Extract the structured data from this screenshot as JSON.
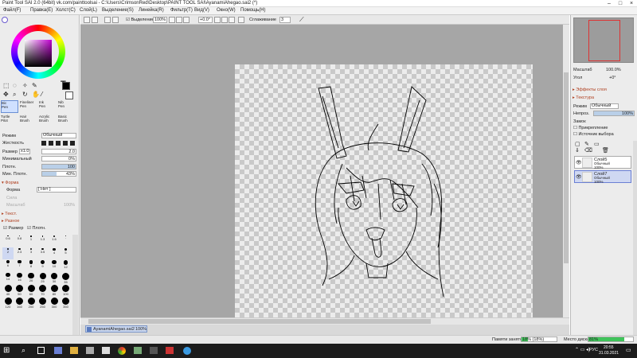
{
  "window": {
    "title": "Paint Tool SAI 2.0 (64bit) vk.com/painttoolsai - C:\\Users\\CrimsonRed\\Desktop\\PAINT TOOL SAI\\AyanamiAhegao.sai2 (*)"
  },
  "menu": [
    "Файл(F)",
    "Правка(E)",
    "Холст(C)",
    "Слой(L)",
    "Выделение(S)",
    "Линейка(R)",
    "Фильтр(T)",
    "Вид(V)",
    "Окно(W)",
    "Помощь(H)"
  ],
  "toolbar": {
    "selection_label": "Выделение",
    "zoom": "100%",
    "rotation": "+0.0°",
    "smoothing_label": "Сглаживание",
    "smoothing": "3"
  },
  "tools": {
    "brushes": [
      [
        "Bic",
        "Pen"
      ],
      [
        "Fineliner",
        "Pen"
      ],
      [
        "Ink",
        "Pen"
      ],
      [
        "Nib",
        "Pen"
      ],
      [
        "Turtle",
        "Pilot"
      ],
      [
        "Hair",
        "Brush"
      ],
      [
        "Acrylic",
        "Brush"
      ],
      [
        "Basic",
        "Brush"
      ]
    ],
    "mode_label": "Режим",
    "mode": "Обычный",
    "hardness_label": "Жесткость",
    "size_label": "Размер",
    "size_mult": "x1.0",
    "size": "2.0",
    "min_label": "Минимальный",
    "min": "0%",
    "density_label": "Плотн.",
    "density": "100",
    "min_density_label": "Мин. Плотн.",
    "min_density": "43%",
    "shape_section": "Форма",
    "shape_label": "Форма",
    "shape": "[ Нет ]",
    "strength_label": "Сила",
    "scale_label": "Масштаб",
    "scale": "100%",
    "texture_section": "Текст.",
    "misc_section": "Разное",
    "size_check": "Размер",
    "density_check": "Плотн.",
    "sizes": [
      0.6,
      0.8,
      1,
      1.3,
      1.6,
      "·",
      2,
      2.3,
      3,
      3.5,
      4,
      5,
      6,
      7,
      8,
      9,
      10,
      12,
      14,
      16,
      20,
      25,
      30,
      35,
      40,
      50,
      60,
      70,
      80,
      100,
      120,
      160,
      200,
      250,
      300,
      350
    ]
  },
  "canvas": {
    "file_tab": "AyanamiAhegao.sai2",
    "file_zoom": "100%"
  },
  "navigator": {
    "zoom_label": "Масштаб",
    "zoom": "100.0%",
    "angle_label": "Угол",
    "angle": "+0°"
  },
  "layer_panel": {
    "effects": "Эффекты слоя",
    "texture": "Текстура",
    "mode_label": "Режим",
    "mode": "Обычный",
    "opacity_label": "Непроз.",
    "opacity": "100%",
    "lock_label": "Замок",
    "clip": "Прикрепление",
    "selection_source": "Источник выбора",
    "layers": [
      {
        "name": "Слой5",
        "mode": "Обычный",
        "opacity": "100%"
      },
      {
        "name": "Слой7",
        "mode": "Обычный",
        "opacity": "100%"
      }
    ]
  },
  "status": {
    "memory_label": "Памяти занято",
    "memory": "18% (18%)",
    "memory_fraction": 0.18,
    "disk_label": "Место диска",
    "disk": "81%",
    "disk_fraction": 0.81
  },
  "taskbar": {
    "lang": "РУС",
    "time": "20:55",
    "date": "31.03.2021"
  },
  "colors": {
    "accent": "#6a8fd4",
    "canvas_bg": "#a6a6a6"
  }
}
